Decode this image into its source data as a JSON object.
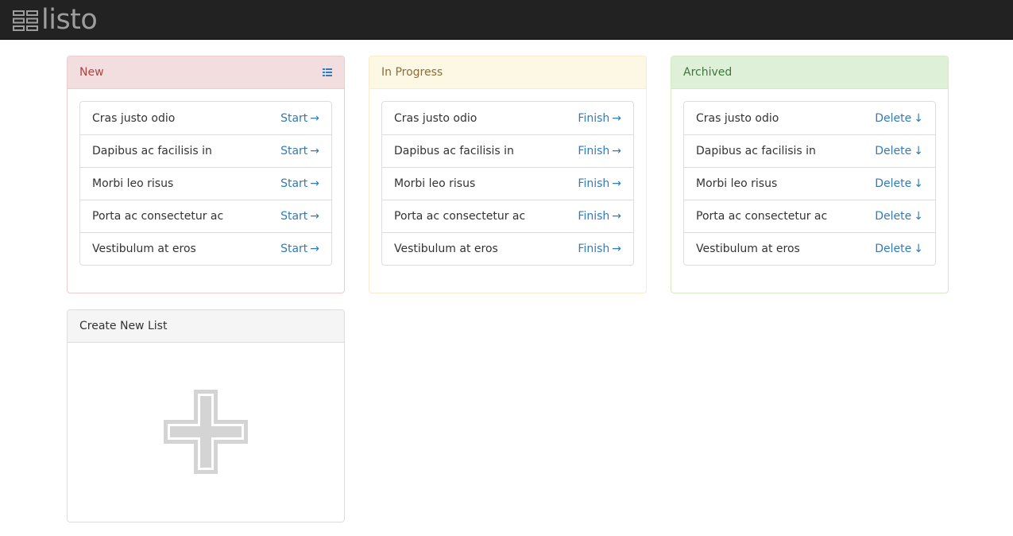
{
  "app": {
    "brand": "listo",
    "logo_icon": "stacked-lines-icon"
  },
  "colors": {
    "navbar": "#222222",
    "link": "#337ab7",
    "new_bg": "#f2dede",
    "new_border": "#ebccd1",
    "new_text": "#a94442",
    "progress_bg": "#fcf8e3",
    "progress_border": "#faebcc",
    "progress_text": "#8a6d3b",
    "archived_bg": "#dff0d8",
    "archived_border": "#d6e9c6",
    "archived_text": "#3c763d"
  },
  "lists": {
    "new": {
      "title": "New",
      "menu_icon": "grid-list-icon",
      "items": [
        {
          "label": "Cras justo odio",
          "action": "Start",
          "arrow": "→"
        },
        {
          "label": "Dapibus ac facilisis in",
          "action": "Start",
          "arrow": "→"
        },
        {
          "label": "Morbi leo risus",
          "action": "Start",
          "arrow": "→"
        },
        {
          "label": "Porta ac consectetur ac",
          "action": "Start",
          "arrow": "→"
        },
        {
          "label": "Vestibulum at eros",
          "action": "Start",
          "arrow": "→"
        }
      ]
    },
    "in_progress": {
      "title": "In Progress",
      "items": [
        {
          "label": "Cras justo odio",
          "action": "Finish",
          "arrow": "→"
        },
        {
          "label": "Dapibus ac facilisis in",
          "action": "Finish",
          "arrow": "→"
        },
        {
          "label": "Morbi leo risus",
          "action": "Finish",
          "arrow": "→"
        },
        {
          "label": "Porta ac consectetur ac",
          "action": "Finish",
          "arrow": "→"
        },
        {
          "label": "Vestibulum at eros",
          "action": "Finish",
          "arrow": "→"
        }
      ]
    },
    "archived": {
      "title": "Archived",
      "items": [
        {
          "label": "Cras justo odio",
          "action": "Delete",
          "arrow": "↓"
        },
        {
          "label": "Dapibus ac facilisis in",
          "action": "Delete",
          "arrow": "↓"
        },
        {
          "label": "Morbi leo risus",
          "action": "Delete",
          "arrow": "↓"
        },
        {
          "label": "Porta ac consectetur ac",
          "action": "Delete",
          "arrow": "↓"
        },
        {
          "label": "Vestibulum at eros",
          "action": "Delete",
          "arrow": "↓"
        }
      ]
    }
  },
  "create": {
    "title": "Create New List",
    "icon": "plus-icon"
  }
}
